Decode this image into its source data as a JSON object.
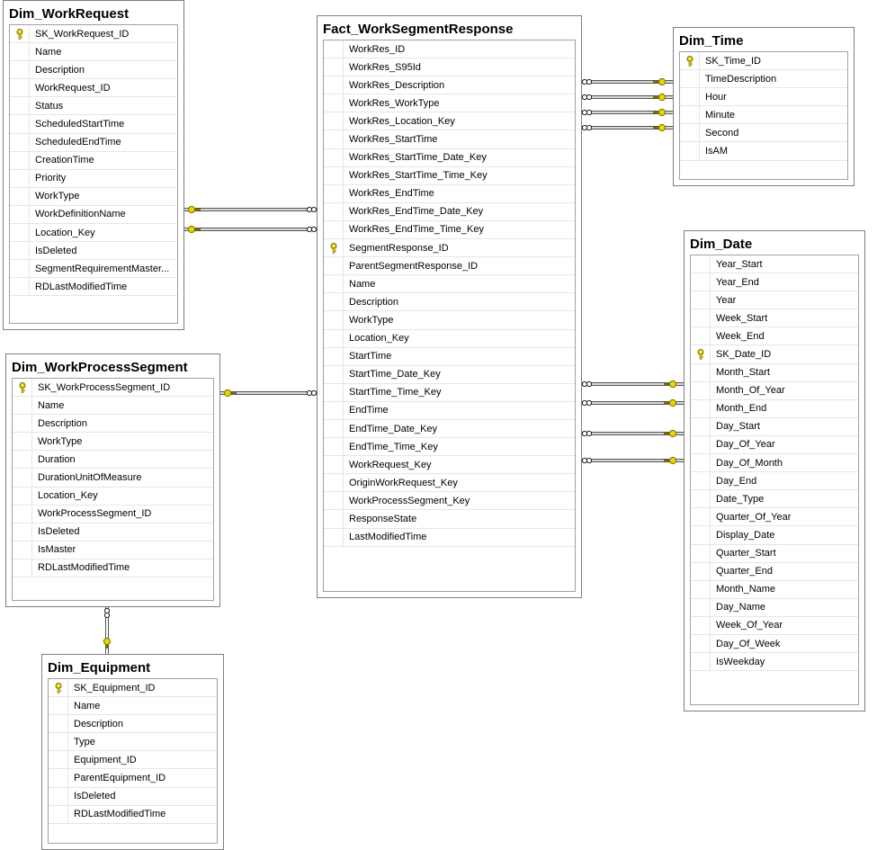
{
  "tables": {
    "dim_workrequest": {
      "title": "Dim_WorkRequest",
      "columns": [
        {
          "name": "SK_WorkRequest_ID",
          "pk": true
        },
        {
          "name": "Name"
        },
        {
          "name": "Description"
        },
        {
          "name": "WorkRequest_ID"
        },
        {
          "name": "Status"
        },
        {
          "name": "ScheduledStartTime"
        },
        {
          "name": "ScheduledEndTime"
        },
        {
          "name": "CreationTime"
        },
        {
          "name": "Priority"
        },
        {
          "name": "WorkType"
        },
        {
          "name": "WorkDefinitionName"
        },
        {
          "name": "Location_Key"
        },
        {
          "name": "IsDeleted"
        },
        {
          "name": "SegmentRequirementMaster..."
        },
        {
          "name": "RDLastModifiedTime"
        }
      ]
    },
    "fact_worksegmentresponse": {
      "title": "Fact_WorkSegmentResponse",
      "columns": [
        {
          "name": "WorkRes_ID"
        },
        {
          "name": "WorkRes_S95Id"
        },
        {
          "name": "WorkRes_Description"
        },
        {
          "name": "WorkRes_WorkType"
        },
        {
          "name": "WorkRes_Location_Key"
        },
        {
          "name": "WorkRes_StartTime"
        },
        {
          "name": "WorkRes_StartTime_Date_Key"
        },
        {
          "name": "WorkRes_StartTime_Time_Key"
        },
        {
          "name": "WorkRes_EndTime"
        },
        {
          "name": "WorkRes_EndTime_Date_Key"
        },
        {
          "name": "WorkRes_EndTime_Time_Key"
        },
        {
          "name": "SegmentResponse_ID",
          "pk": true
        },
        {
          "name": "ParentSegmentResponse_ID"
        },
        {
          "name": "Name"
        },
        {
          "name": "Description"
        },
        {
          "name": "WorkType"
        },
        {
          "name": "Location_Key"
        },
        {
          "name": "StartTime"
        },
        {
          "name": "StartTime_Date_Key"
        },
        {
          "name": "StartTime_Time_Key"
        },
        {
          "name": "EndTime"
        },
        {
          "name": "EndTime_Date_Key"
        },
        {
          "name": "EndTime_Time_Key"
        },
        {
          "name": "WorkRequest_Key"
        },
        {
          "name": "OriginWorkRequest_Key"
        },
        {
          "name": "WorkProcessSegment_Key"
        },
        {
          "name": "ResponseState"
        },
        {
          "name": "LastModifiedTime"
        }
      ]
    },
    "dim_time": {
      "title": "Dim_Time",
      "columns": [
        {
          "name": "SK_Time_ID",
          "pk": true
        },
        {
          "name": "TimeDescription"
        },
        {
          "name": "Hour"
        },
        {
          "name": "Minute"
        },
        {
          "name": "Second"
        },
        {
          "name": "IsAM"
        }
      ]
    },
    "dim_date": {
      "title": "Dim_Date",
      "columns": [
        {
          "name": "Year_Start"
        },
        {
          "name": "Year_End"
        },
        {
          "name": "Year"
        },
        {
          "name": "Week_Start"
        },
        {
          "name": "Week_End"
        },
        {
          "name": "SK_Date_ID",
          "pk": true
        },
        {
          "name": "Month_Start"
        },
        {
          "name": "Month_Of_Year"
        },
        {
          "name": "Month_End"
        },
        {
          "name": "Day_Start"
        },
        {
          "name": "Day_Of_Year"
        },
        {
          "name": "Day_Of_Month"
        },
        {
          "name": "Day_End"
        },
        {
          "name": "Date_Type"
        },
        {
          "name": "Quarter_Of_Year"
        },
        {
          "name": "Display_Date"
        },
        {
          "name": "Quarter_Start"
        },
        {
          "name": "Quarter_End"
        },
        {
          "name": "Month_Name"
        },
        {
          "name": "Day_Name"
        },
        {
          "name": "Week_Of_Year"
        },
        {
          "name": "Day_Of_Week"
        },
        {
          "name": "IsWeekday"
        }
      ]
    },
    "dim_workprocesssegment": {
      "title": "Dim_WorkProcessSegment",
      "columns": [
        {
          "name": "SK_WorkProcessSegment_ID",
          "pk": true
        },
        {
          "name": "Name"
        },
        {
          "name": "Description"
        },
        {
          "name": "WorkType"
        },
        {
          "name": "Duration"
        },
        {
          "name": "DurationUnitOfMeasure"
        },
        {
          "name": "Location_Key"
        },
        {
          "name": "WorkProcessSegment_ID"
        },
        {
          "name": "IsDeleted"
        },
        {
          "name": "IsMaster"
        },
        {
          "name": "RDLastModifiedTime"
        }
      ]
    },
    "dim_equipment": {
      "title": "Dim_Equipment",
      "columns": [
        {
          "name": "SK_Equipment_ID",
          "pk": true
        },
        {
          "name": "Name"
        },
        {
          "name": "Description"
        },
        {
          "name": "Type"
        },
        {
          "name": "Equipment_ID"
        },
        {
          "name": "ParentEquipment_ID"
        },
        {
          "name": "IsDeleted"
        },
        {
          "name": "RDLastModifiedTime"
        }
      ]
    }
  },
  "icons": {
    "primary_key": "key-icon",
    "relationship_end_one": "key-icon",
    "relationship_end_many": "infinity-icon"
  },
  "colors": {
    "key": "#e8d400",
    "key_stroke": "#7a6e00",
    "table_border": "#7f7f7f",
    "link": "#555555"
  }
}
